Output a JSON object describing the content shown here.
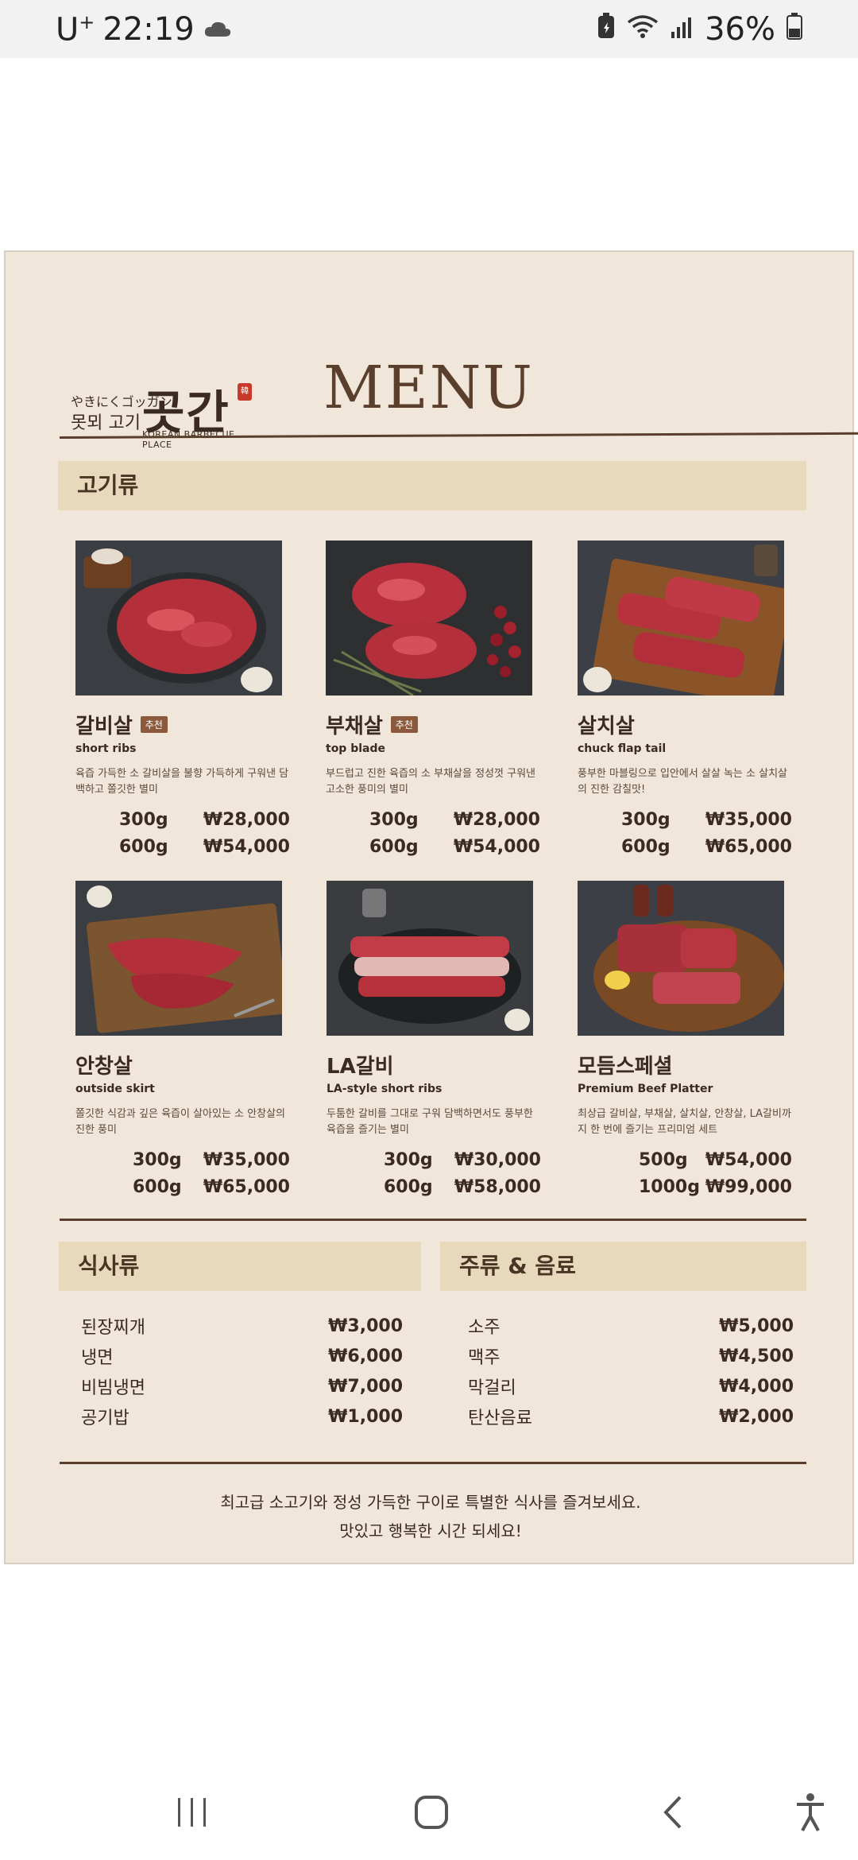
{
  "status_bar": {
    "carrier": "U",
    "carrier_sup": "+",
    "time": "22:19",
    "battery": "36%"
  },
  "menu": {
    "logo": {
      "small_line1": "やきにくゴッガン",
      "small_line2": "못뫼 고기",
      "brand": "곳간",
      "stamp": "韓",
      "tagline": "KOREAN BARBECUE PLACE"
    },
    "title": "MENU",
    "meat_section": "고기류",
    "meat_items": [
      {
        "name": "갈비살",
        "badge": "추천",
        "en": "short ribs",
        "desc": "육즙 가득한 소 갈비살을 불향 가득하게 구워낸 담백하고 쫄깃한 별미",
        "prices": [
          {
            "w": "300g",
            "p": "₩28,000"
          },
          {
            "w": "600g",
            "p": "₩54,000"
          }
        ]
      },
      {
        "name": "부채살",
        "badge": "추천",
        "en": "top blade",
        "desc": "부드럽고 진한 육즙의 소 부채살을 정성껏 구워낸 고소한 풍미의 별미",
        "prices": [
          {
            "w": "300g",
            "p": "₩28,000"
          },
          {
            "w": "600g",
            "p": "₩54,000"
          }
        ]
      },
      {
        "name": "살치살",
        "badge": "",
        "en": "chuck flap tail",
        "desc": "풍부한 마블링으로 입안에서 살살 녹는 소 살치살의 진한 감칠맛!",
        "prices": [
          {
            "w": "300g",
            "p": "₩35,000"
          },
          {
            "w": "600g",
            "p": "₩65,000"
          }
        ]
      },
      {
        "name": "안창살",
        "badge": "",
        "en": "outside skirt",
        "desc": "쫄깃한 식감과 깊은 육즙이 살아있는 소 안창살의 진한 풍미",
        "prices": [
          {
            "w": "300g",
            "p": "₩35,000"
          },
          {
            "w": "600g",
            "p": "₩65,000"
          }
        ]
      },
      {
        "name": "LA갈비",
        "badge": "",
        "en": "LA-style short ribs",
        "desc": "두툼한 갈비를 그대로 구워 담백하면서도 풍부한 육즙을 즐기는 별미",
        "prices": [
          {
            "w": "300g",
            "p": "₩30,000"
          },
          {
            "w": "600g",
            "p": "₩58,000"
          }
        ]
      },
      {
        "name": "모듬스페셜",
        "badge": "",
        "en": "Premium Beef Platter",
        "desc": "최상급 갈비살, 부채살, 살치살, 안창살, LA갈비까지 한 번에 즐기는 프리미엄 세트",
        "prices": [
          {
            "w": "500g",
            "p": "₩54,000"
          },
          {
            "w": "1000g",
            "p": "₩99,000"
          }
        ]
      }
    ],
    "meals_section": "식사류",
    "meals": [
      {
        "name": "된장찌개",
        "price": "₩3,000"
      },
      {
        "name": "냉면",
        "price": "₩6,000"
      },
      {
        "name": "비빔냉면",
        "price": "₩7,000"
      },
      {
        "name": "공기밥",
        "price": "₩1,000"
      }
    ],
    "drinks_section": "주류 & 음료",
    "drinks": [
      {
        "name": "소주",
        "price": "₩5,000"
      },
      {
        "name": "맥주",
        "price": "₩4,500"
      },
      {
        "name": "막걸리",
        "price": "₩4,000"
      },
      {
        "name": "탄산음료",
        "price": "₩2,000"
      }
    ],
    "footer_line1": "최고급 소고기와 정성 가득한 구이로 특별한 식사를 즐겨보세요.",
    "footer_line2": "맛있고 행복한 시간 되세요!"
  },
  "colors": {
    "sheet_bg": "#f0e6d9",
    "section_bg": "#e8d9bd",
    "accent": "#5a3f2d",
    "badge": "#8b5a3c"
  },
  "icons": {
    "cloud": "cloud-icon",
    "battery_saver": "battery-saver-icon",
    "wifi": "wifi-icon",
    "signal": "signal-icon",
    "battery": "battery-icon",
    "recents": "recents-icon",
    "home": "home-icon",
    "back": "back-icon",
    "accessibility": "accessibility-icon"
  }
}
